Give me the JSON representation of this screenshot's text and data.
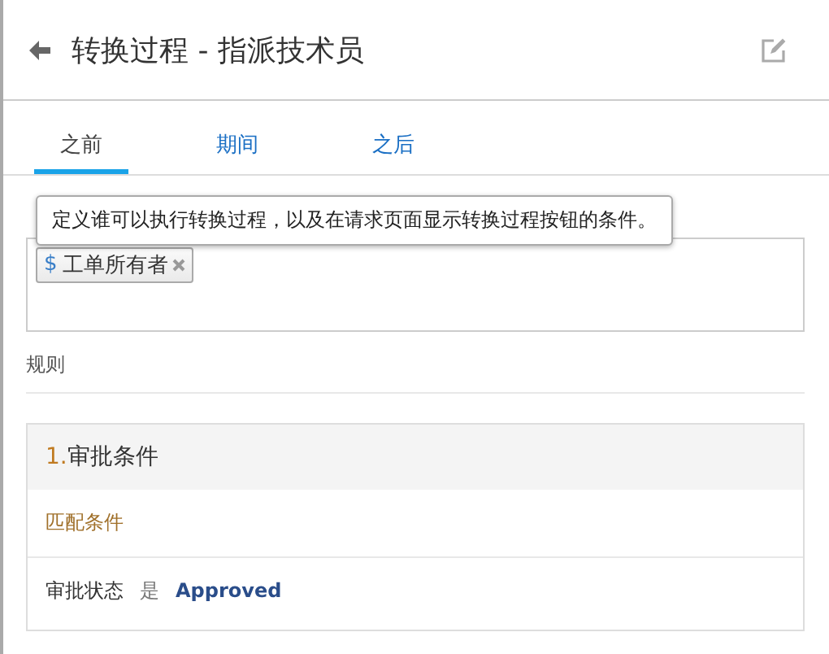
{
  "header": {
    "title": "转换过程 - 指派技术员"
  },
  "tabs": [
    {
      "label": "之前",
      "selected": true
    },
    {
      "label": "期间",
      "selected": false
    },
    {
      "label": "之后",
      "selected": false
    }
  ],
  "tooltip": {
    "text": "定义谁可以执行转换过程，以及在请求页面显示转换过程按钮的条件。"
  },
  "participants_field": {
    "chips": [
      {
        "prefix": "$",
        "label": "工单所有者"
      }
    ]
  },
  "rules_label": "规则",
  "rules": [
    {
      "number": "1.",
      "title": "审批条件",
      "match_label": "匹配条件",
      "conditions": [
        {
          "field": "审批状态",
          "operator": "是",
          "value": "Approved"
        }
      ]
    }
  ]
}
